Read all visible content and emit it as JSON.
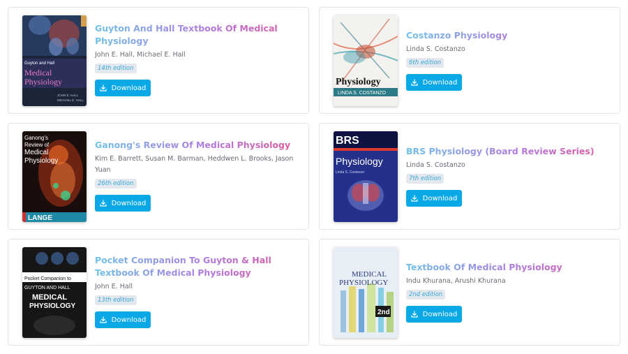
{
  "books": [
    {
      "title": "Guyton And Hall Textbook Of Medical Physiology",
      "authors": "John E. Hall, Michael E. Hall",
      "edition": "14th edition",
      "download_label": "Download",
      "cover": {
        "line1": "Guyton and Hall",
        "line2": "Medical",
        "line3": "Physiology",
        "line4": "JOHN E. HALL",
        "line5": "MICHAEL E. HALL"
      }
    },
    {
      "title": "Costanzo Physiology",
      "authors": "Linda S. Costanzo",
      "edition": "6th edition",
      "download_label": "Download",
      "cover": {
        "line1": "Physiology",
        "line2": "LINDA S. COSTANZO"
      }
    },
    {
      "title": "Ganong's Review Of Medical Physiology",
      "authors": "Kim E. Barrett, Susan M. Barman, Heddwen L. Brooks, Jason Yuan",
      "edition": "26th edition",
      "download_label": "Download",
      "cover": {
        "line1": "Ganong's",
        "line2": "Review of",
        "line3": "Medical",
        "line4": "Physiology",
        "line5": "LANGE"
      }
    },
    {
      "title": "BRS Physiology (Board Review Series)",
      "authors": "Linda S. Costanzo",
      "edition": "7th edition",
      "download_label": "Download",
      "cover": {
        "line1": "BRS",
        "line2": "Physiology",
        "line3": "Linda S. Costanzo"
      }
    },
    {
      "title": "Pocket Companion To Guyton & Hall Textbook Of Medical Physiology",
      "authors": "John E. Hall",
      "edition": "13th edition",
      "download_label": "Download",
      "cover": {
        "line1": "Pocket Companion to",
        "line2": "GUYTON AND HALL",
        "line3": "MEDICAL",
        "line4": "PHYSIOLOGY"
      }
    },
    {
      "title": "Textbook Of Medical Physiology",
      "authors": "Indu Khurana, Arushi Khurana",
      "edition": "2nd edition",
      "download_label": "Download",
      "cover": {
        "line1": "MEDICAL",
        "line2": "PHYSIOLOGY",
        "line3": "2nd"
      }
    }
  ]
}
